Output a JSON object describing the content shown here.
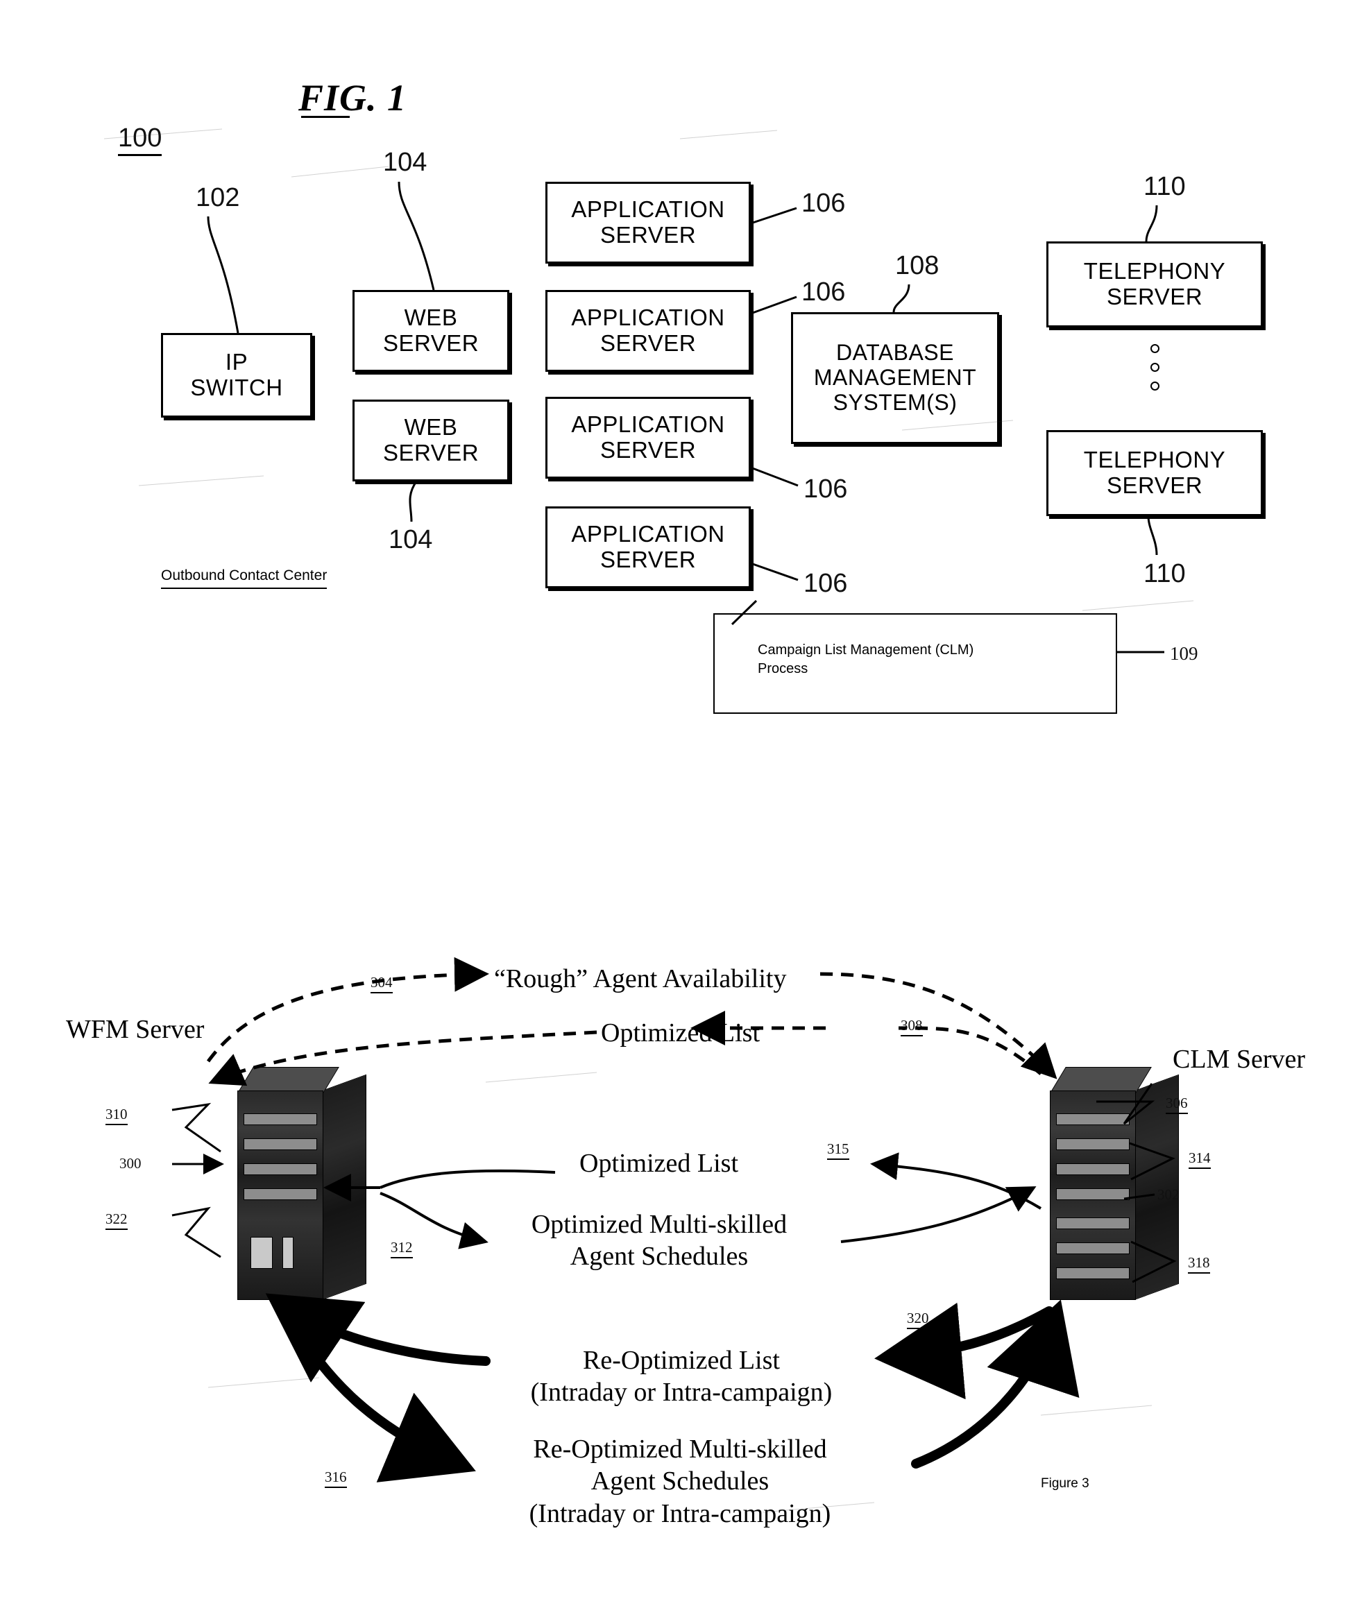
{
  "page": {
    "background_color": "#ffffff",
    "ink_color": "#000000"
  },
  "figure1": {
    "title": "FIG. 1",
    "system_ref": "100",
    "enclosure_caption": "Outbound Contact Center",
    "blocks": [
      {
        "id": "ip-switch",
        "lines": [
          "IP",
          "SWITCH"
        ],
        "ref": "102"
      },
      {
        "id": "web-server-1",
        "lines": [
          "WEB",
          "SERVER"
        ],
        "ref": "104"
      },
      {
        "id": "web-server-2",
        "lines": [
          "WEB",
          "SERVER"
        ],
        "ref": "104"
      },
      {
        "id": "app-server-1",
        "lines": [
          "APPLICATION",
          "SERVER"
        ],
        "ref": "106"
      },
      {
        "id": "app-server-2",
        "lines": [
          "APPLICATION",
          "SERVER"
        ],
        "ref": "106"
      },
      {
        "id": "app-server-3",
        "lines": [
          "APPLICATION",
          "SERVER"
        ],
        "ref": "106"
      },
      {
        "id": "app-server-4",
        "lines": [
          "APPLICATION",
          "SERVER"
        ],
        "ref": "106"
      },
      {
        "id": "dbms",
        "lines": [
          "DATABASE",
          "MANAGEMENT",
          "SYSTEM(S)"
        ],
        "ref": "108"
      },
      {
        "id": "telephony-1",
        "lines": [
          "TELEPHONY",
          "SERVER"
        ],
        "ref": "110"
      },
      {
        "id": "telephony-2",
        "lines": [
          "TELEPHONY",
          "SERVER"
        ],
        "ref": "110"
      }
    ],
    "clm_box": {
      "line1": "Campaign List Management (CLM)",
      "line2": "Process",
      "ref": "109"
    },
    "refs": {
      "r100": "100",
      "r102": "102",
      "r104_top": "104",
      "r104_bottom": "104",
      "r106_1": "106",
      "r106_2": "106",
      "r106_3": "106",
      "r106_4": "106",
      "r108": "108",
      "r109": "109",
      "r110_top": "110",
      "r110_bottom": "110"
    }
  },
  "figure3": {
    "caption": "Figure 3",
    "left_server_name": "WFM Server",
    "right_server_name": "CLM Server",
    "flows": [
      {
        "id": "rough-agent-availability",
        "text": "“Rough” Agent Availability",
        "ref": "304",
        "direction": "left-to-right",
        "style": "dashed"
      },
      {
        "id": "optimized-list-dashed",
        "text": "Optimized List",
        "ref": "308",
        "direction": "right-to-left",
        "style": "dashed"
      },
      {
        "id": "optimized-list-solid",
        "text": "Optimized List",
        "ref": "315",
        "direction": "right-to-left",
        "style": "solid"
      },
      {
        "id": "optimized-schedules",
        "text_line1": "Optimized Multi-skilled",
        "text_line2": "Agent Schedules",
        "ref": "312",
        "direction": "left-to-right",
        "style": "solid"
      },
      {
        "id": "re-optimized-list",
        "text_line1": "Re-Optimized List",
        "text_line2": "(Intraday or Intra-campaign)",
        "ref": "320",
        "direction": "right-to-left",
        "style": "bold"
      },
      {
        "id": "re-optimized-schedules",
        "text_line1": "Re-Optimized Multi-skilled",
        "text_line2": "Agent Schedules",
        "text_line3": "(Intraday or Intra-campaign)",
        "ref": "316",
        "direction": "left-to-right",
        "style": "bold"
      }
    ],
    "left_refs": {
      "r310": "310",
      "r300": "300",
      "r322": "322"
    },
    "right_refs": {
      "r306": "306",
      "r314": "314",
      "r302": "302",
      "r318": "318"
    },
    "flow_refs": {
      "r304": "304",
      "r308": "308",
      "r312": "312",
      "r315": "315",
      "r316": "316",
      "r320": "320"
    }
  }
}
